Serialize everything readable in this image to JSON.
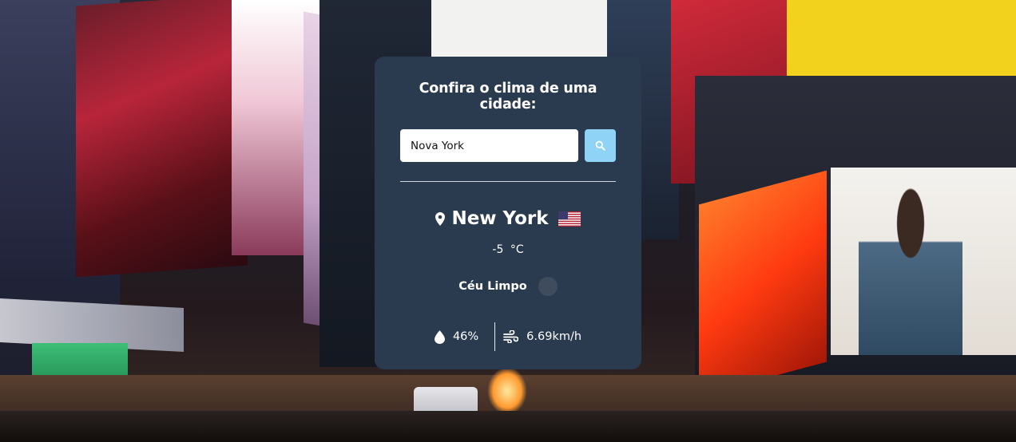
{
  "card": {
    "heading": "Confira o clima de uma cidade:",
    "search": {
      "value": "Nova York",
      "button_icon": "search-icon"
    }
  },
  "weather": {
    "location_icon": "map-pin-icon",
    "city": "New York",
    "flag_icon": "us-flag-icon",
    "temperature": "-5",
    "temperature_unit": "°C",
    "description": "Céu Limpo",
    "condition_icon": "weather-condition-icon",
    "humidity_icon": "droplet-icon",
    "humidity": "46%",
    "wind_icon": "wind-icon",
    "wind": "6.69km/h"
  },
  "colors": {
    "card_background": "#2b3b4f",
    "search_button": "#8fd3f7",
    "text": "#ffffff"
  }
}
